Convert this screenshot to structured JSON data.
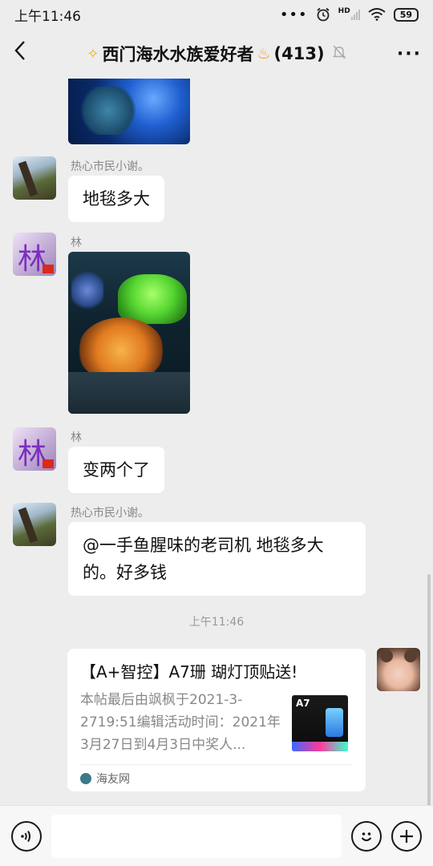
{
  "status": {
    "time": "上午11:46",
    "battery": "59",
    "hd": "HD"
  },
  "header": {
    "title": "西门海水水族爱好者",
    "member_count": "(413)",
    "back_icon": "chevron-left-icon",
    "more_icon": "more-dots-icon",
    "mute_icon": "muted-bell-icon"
  },
  "messages": [
    {
      "sender": "热心市民小谢。",
      "text": "地毯多大"
    },
    {
      "sender": "林",
      "type": "image"
    },
    {
      "sender": "林",
      "text": "变两个了"
    },
    {
      "sender": "热心市民小谢。",
      "text": "@一手鱼腥味的老司机  地毯多大的。好多钱"
    }
  ],
  "timestamp": "上午11:46",
  "avatar_text": "林",
  "link_card": {
    "title": "【A+智控】A7珊 瑚灯顶贴送!",
    "description": "本帖最后由飒枫于2021-3-2719:51编辑活动时间：2021年3月27日到4月3日中奖人...",
    "source": "海友网",
    "thumb_label": "A7"
  },
  "input_bar": {
    "voice_icon": "voice-icon",
    "emoji_icon": "emoji-icon",
    "plus_icon": "plus-icon",
    "placeholder": ""
  }
}
